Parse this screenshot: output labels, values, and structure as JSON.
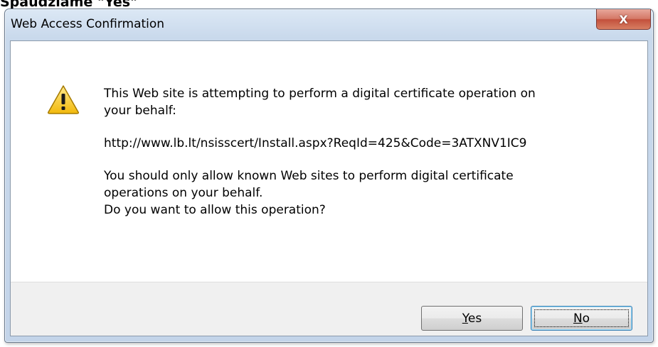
{
  "caption": {
    "text": "Spaudžiame \"Yes\""
  },
  "window": {
    "title": "Web Access Confirmation",
    "close_glyph": "X"
  },
  "message": {
    "line1": "This Web site is attempting to perform a digital certificate operation on",
    "line2": "your behalf:",
    "url": "http://www.lb.lt/nsisscert/Install.aspx?ReqId=425&Code=3ATXNV1IC9",
    "line3": "You should only allow known Web sites to perform digital certificate",
    "line4": "operations on your behalf.",
    "line5": "Do you want to allow this operation?"
  },
  "icon": {
    "name": "warning-icon",
    "fill": "#f5c81f",
    "stroke": "#b08000"
  },
  "buttons": {
    "yes": {
      "accel": "Y",
      "rest": "es"
    },
    "no": {
      "accel": "N",
      "rest": "o"
    }
  }
}
